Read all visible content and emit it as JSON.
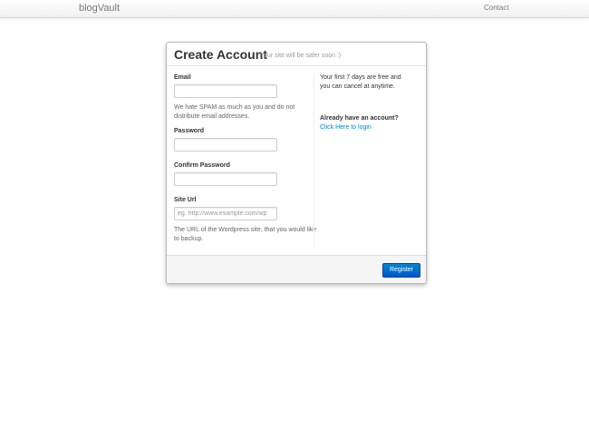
{
  "navbar": {
    "brand": "blogVault",
    "contact_label": "Contact"
  },
  "modal": {
    "title": "Create Account",
    "subtitle": "Your site will be safer soon :)"
  },
  "form": {
    "email_label": "Email",
    "email_value": "",
    "email_help": "We hate SPAM as much as you and do not distribute email addresses.",
    "password_label": "Password",
    "password_value": "",
    "confirm_password_label": "Confirm Password",
    "confirm_password_value": "",
    "site_url_label": "Site Url",
    "site_url_value": "",
    "site_url_placeholder": "eg. http://www.example.com/wp",
    "site_url_help": "The URL of the Wordpress site, that you would like to backup."
  },
  "sidebar": {
    "trial_text": "Your first 7 days are free and you can cancel at anytime.",
    "account_question": "Already have an account?",
    "login_link": "Click Here to login"
  },
  "footer": {
    "register_label": "Register"
  }
}
